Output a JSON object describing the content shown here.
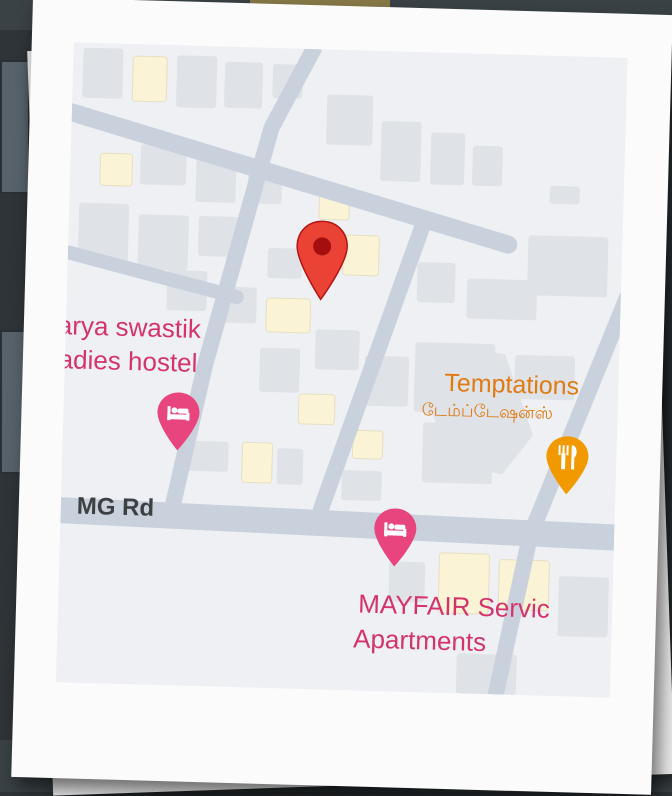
{
  "map": {
    "pin_color": "#ea4335",
    "hotel_color": "#d6336c",
    "food_color": "#f29900",
    "road_color": "#c9d1dc",
    "building_color": "#dfe2e6",
    "highlight_building_color": "#fbf3d5"
  },
  "places": {
    "hostel": {
      "line1": "arya swastik",
      "line2": "ladies hostel",
      "icon": "bed-icon"
    },
    "restaurant": {
      "name": "Temptations",
      "name_ta": "டேம்ப்டேஷன்ஸ்",
      "icon": "fork-knife-icon"
    },
    "apartments": {
      "line1": "MAYFAIR Servic",
      "line2": "Apartments",
      "icon": "bed-icon"
    }
  },
  "roads": {
    "main": "MG Rd"
  },
  "pin": {
    "icon": "location-pin-icon"
  }
}
